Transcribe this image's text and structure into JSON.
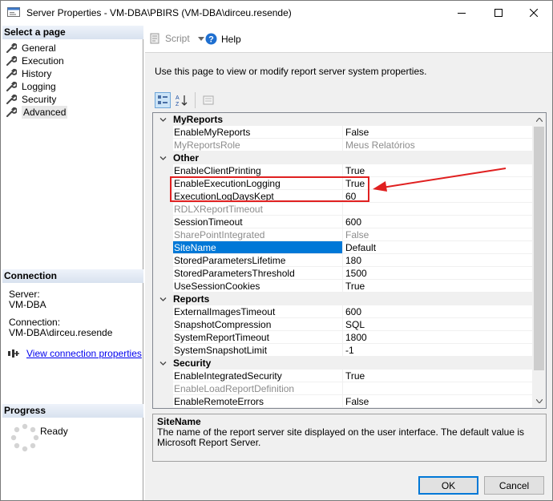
{
  "window": {
    "title": "Server Properties - VM-DBA\\PBIRS (VM-DBA\\dirceu.resende)"
  },
  "left": {
    "select_page_header": "Select a page",
    "pages": [
      {
        "label": "General"
      },
      {
        "label": "Execution"
      },
      {
        "label": "History"
      },
      {
        "label": "Logging"
      },
      {
        "label": "Security"
      },
      {
        "label": "Advanced",
        "selected": true
      }
    ],
    "connection_header": "Connection",
    "server_label": "Server:",
    "server_value": "VM-DBA",
    "connection_label": "Connection:",
    "connection_value": "VM-DBA\\dirceu.resende",
    "view_connection_link": "View connection properties",
    "progress_header": "Progress",
    "progress_status": "Ready"
  },
  "toolbar": {
    "script_label": "Script",
    "help_label": "Help"
  },
  "main": {
    "description": "Use this page to view or modify report server system properties."
  },
  "grid": {
    "categories": [
      {
        "name": "MyReports",
        "rows": [
          {
            "name": "EnableMyReports",
            "value": "False"
          },
          {
            "name": "MyReportsRole",
            "value": "Meus Relatórios",
            "disabled": true
          }
        ]
      },
      {
        "name": "Other",
        "rows": [
          {
            "name": "EnableClientPrinting",
            "value": "True"
          },
          {
            "name": "EnableExecutionLogging",
            "value": "True"
          },
          {
            "name": "ExecutionLogDaysKept",
            "value": "60"
          },
          {
            "name": "RDLXReportTimeout",
            "value": "",
            "disabled": true
          },
          {
            "name": "SessionTimeout",
            "value": "600"
          },
          {
            "name": "SharePointIntegrated",
            "value": "False",
            "disabled": true
          },
          {
            "name": "SiteName",
            "value": "Default",
            "selected": true
          },
          {
            "name": "StoredParametersLifetime",
            "value": "180"
          },
          {
            "name": "StoredParametersThreshold",
            "value": "1500"
          },
          {
            "name": "UseSessionCookies",
            "value": "True"
          }
        ]
      },
      {
        "name": "Reports",
        "rows": [
          {
            "name": "ExternalImagesTimeout",
            "value": "600"
          },
          {
            "name": "SnapshotCompression",
            "value": "SQL"
          },
          {
            "name": "SystemReportTimeout",
            "value": "1800"
          },
          {
            "name": "SystemSnapshotLimit",
            "value": "-1"
          }
        ]
      },
      {
        "name": "Security",
        "rows": [
          {
            "name": "EnableIntegratedSecurity",
            "value": "True"
          },
          {
            "name": "EnableLoadReportDefinition",
            "value": "",
            "disabled": true
          },
          {
            "name": "EnableRemoteErrors",
            "value": "False"
          }
        ]
      }
    ]
  },
  "help": {
    "title": "SiteName",
    "text": "The name of the report server site displayed on the user interface. The default value is Microsoft Report Server."
  },
  "buttons": {
    "ok": "OK",
    "cancel": "Cancel"
  },
  "colors": {
    "selection": "#0078d7",
    "annotation": "#e02020",
    "link": "#0000ee"
  }
}
